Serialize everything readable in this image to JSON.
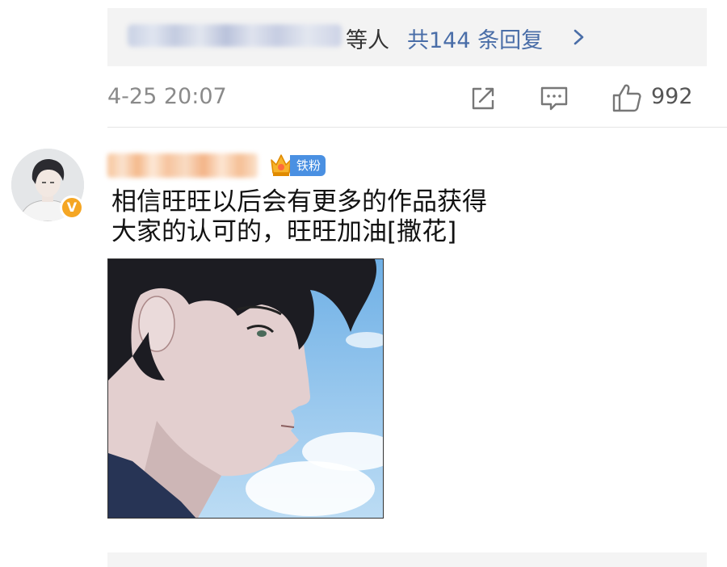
{
  "reply_summary": {
    "suffix": "等人",
    "count_link": "共144 条回复"
  },
  "meta": {
    "timestamp": "4-25 20:07",
    "like_count": "992"
  },
  "comment": {
    "fan_badge": "铁粉",
    "verified_mark": "V",
    "text_line1": "相信旺旺以后会有更多的作品获得",
    "text_line2": "大家的认可的，旺旺加油[撒花]"
  },
  "icons": {
    "share": "share-icon",
    "comment": "comment-icon",
    "like": "thumbs-up-icon",
    "chevron": "chevron-right-icon",
    "crown": "crown-icon"
  },
  "colors": {
    "link_blue": "#4a6ea8",
    "fan_badge_blue": "#4a90e2",
    "verified_orange": "#f5a623",
    "meta_gray": "#8a8a8a"
  }
}
